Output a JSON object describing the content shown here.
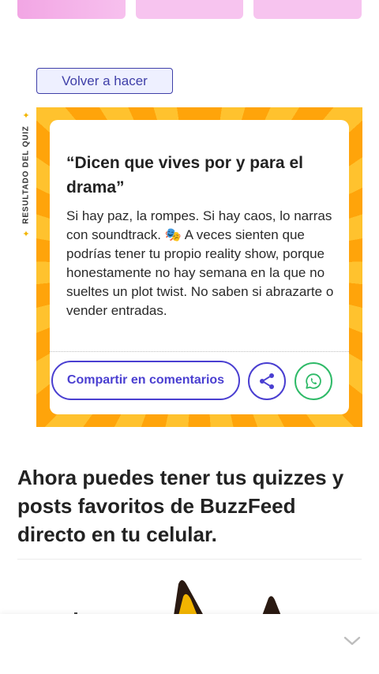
{
  "quiz": {
    "retake_label": "Volver a hacer",
    "side_label": "RESULTADO DEL QUIZ",
    "sparkle_icon": "sparkle-icon"
  },
  "result": {
    "title": "“Dicen que vives por y para el drama”",
    "description": "Si hay paz, la rompes. Si hay caos, lo narras con soundtrack. 🎭 A veces sienten que podrías tener tu propio reality show, porque honestamente no hay semana en la que no sueltes un plot twist. No saben si abrazarte o vender entradas.",
    "share_comments_label": "Compartir en comentarios",
    "share_icon": "share-icon",
    "whatsapp_icon": "whatsapp-icon"
  },
  "promo": {
    "text": "Ahora puedes tener tus quizzes y posts favoritos de BuzzFeed directo en tu celular."
  },
  "colors": {
    "accent": "#4a3fd1",
    "frame_orange": "#ffa40a",
    "whatsapp_green": "#2fba68",
    "answer_pink": "#f7c4ef"
  }
}
